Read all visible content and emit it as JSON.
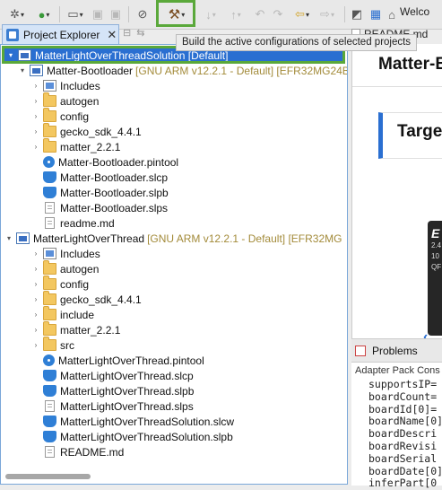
{
  "toolbar": {
    "build_tooltip": "Build the active configurations of selected projects",
    "welcome_tab": "Welco"
  },
  "project_explorer": {
    "tab_label": "Project Explorer",
    "tree": [
      {
        "label": "MatterLightOverThreadSolution [Default]",
        "meta": "",
        "icon": "solution-icon",
        "indent": 0,
        "twisty": "▾",
        "selected": true
      },
      {
        "label": "Matter-Bootloader",
        "meta": "[GNU ARM v12.2.1 - Default] [EFR32MG24B",
        "icon": "project-icon",
        "indent": 1,
        "twisty": "▾"
      },
      {
        "label": "Includes",
        "meta": "",
        "icon": "includes-icon",
        "indent": 2,
        "twisty": "›"
      },
      {
        "label": "autogen",
        "meta": "",
        "icon": "folder-icon",
        "indent": 2,
        "twisty": "›"
      },
      {
        "label": "config",
        "meta": "",
        "icon": "folder-icon",
        "indent": 2,
        "twisty": "›"
      },
      {
        "label": "gecko_sdk_4.4.1",
        "meta": "",
        "icon": "folder-icon",
        "indent": 2,
        "twisty": "›"
      },
      {
        "label": "matter_2.2.1",
        "meta": "",
        "icon": "folder-icon",
        "indent": 2,
        "twisty": "›"
      },
      {
        "label": "Matter-Bootloader.pintool",
        "meta": "",
        "icon": "pintool-icon",
        "indent": 2,
        "twisty": ""
      },
      {
        "label": "Matter-Bootloader.slcp",
        "meta": "",
        "icon": "slcp-icon",
        "indent": 2,
        "twisty": ""
      },
      {
        "label": "Matter-Bootloader.slpb",
        "meta": "",
        "icon": "slpb-icon",
        "indent": 2,
        "twisty": ""
      },
      {
        "label": "Matter-Bootloader.slps",
        "meta": "",
        "icon": "file-icon",
        "indent": 2,
        "twisty": ""
      },
      {
        "label": "readme.md",
        "meta": "",
        "icon": "file-icon",
        "indent": 2,
        "twisty": ""
      },
      {
        "label": "MatterLightOverThread",
        "meta": "[GNU ARM v12.2.1 - Default] [EFR32MG",
        "icon": "project-icon",
        "indent": 0,
        "twisty": "▾"
      },
      {
        "label": "Includes",
        "meta": "",
        "icon": "includes-icon",
        "indent": 2,
        "twisty": "›"
      },
      {
        "label": "autogen",
        "meta": "",
        "icon": "folder-icon",
        "indent": 2,
        "twisty": "›"
      },
      {
        "label": "config",
        "meta": "",
        "icon": "folder-icon",
        "indent": 2,
        "twisty": "›"
      },
      {
        "label": "gecko_sdk_4.4.1",
        "meta": "",
        "icon": "folder-icon",
        "indent": 2,
        "twisty": "›"
      },
      {
        "label": "include",
        "meta": "",
        "icon": "folder-icon",
        "indent": 2,
        "twisty": "›"
      },
      {
        "label": "matter_2.2.1",
        "meta": "",
        "icon": "folder-icon",
        "indent": 2,
        "twisty": "›"
      },
      {
        "label": "src",
        "meta": "",
        "icon": "folder-icon",
        "indent": 2,
        "twisty": "›"
      },
      {
        "label": "MatterLightOverThread.pintool",
        "meta": "",
        "icon": "pintool-icon",
        "indent": 2,
        "twisty": ""
      },
      {
        "label": "MatterLightOverThread.slcp",
        "meta": "",
        "icon": "slcp-icon",
        "indent": 2,
        "twisty": ""
      },
      {
        "label": "MatterLightOverThread.slpb",
        "meta": "",
        "icon": "slpb-icon",
        "indent": 2,
        "twisty": ""
      },
      {
        "label": "MatterLightOverThread.slps",
        "meta": "",
        "icon": "file-icon",
        "indent": 2,
        "twisty": ""
      },
      {
        "label": "MatterLightOverThreadSolution.slcw",
        "meta": "",
        "icon": "slcp-icon",
        "indent": 2,
        "twisty": ""
      },
      {
        "label": "MatterLightOverThreadSolution.slpb",
        "meta": "",
        "icon": "slpb-icon",
        "indent": 2,
        "twisty": ""
      },
      {
        "label": "README.md",
        "meta": "",
        "icon": "file-icon",
        "indent": 2,
        "twisty": ""
      }
    ]
  },
  "editor": {
    "tab_label": "README.md",
    "title": "Matter-E",
    "section": "Targe",
    "card_lines": [
      "E",
      "2.4",
      "10",
      "QF"
    ]
  },
  "problems": {
    "tab_label": "Problems",
    "console_title": "Adapter Pack Cons",
    "lines": [
      "supportsIP=",
      "boardCount=",
      "boardId[0]=",
      "boardName[0]",
      "boardDescri",
      "boardRevisi",
      "boardSerial",
      "boardDate[0]",
      "inferPart[0"
    ]
  },
  "colors": {
    "selection": "#2a6fd1",
    "highlight_box": "#5aa83a",
    "decoration_text": "#a38b3a"
  }
}
